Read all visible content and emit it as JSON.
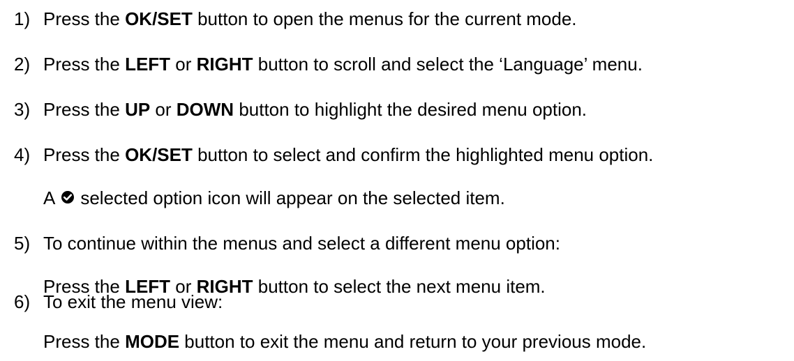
{
  "steps": [
    {
      "num": "1)",
      "p1": "Press the ",
      "b1": "OK/SET",
      "p2": " button to open the menus for the current mode."
    },
    {
      "num": "2)",
      "p1": "Press the ",
      "b1": "LEFT",
      "p2": " or ",
      "b2": "RIGHT",
      "p3": " button to scroll and select the ‘Language’ menu."
    },
    {
      "num": "3)",
      "p1": "Press the ",
      "b1": "UP",
      "p2": " or ",
      "b2": "DOWN",
      "p3": " button to highlight the desired menu option."
    },
    {
      "num": "4)",
      "p1": "Press the ",
      "b1": "OK/SET",
      "p2": " button to select and confirm the highlighted menu option.",
      "sub_p1": "A",
      "sub_p2": "selected option icon will appear on the selected item."
    },
    {
      "num": "5)",
      "p1": "To continue within the menus and select a different menu option:",
      "sub_p1": "Press the ",
      "sub_b1": "LEFT",
      "sub_p2": " or ",
      "sub_b2": "RIGHT",
      "sub_p3": " button to select the next menu item."
    },
    {
      "num": "6)",
      "p1": "To exit the menu view:",
      "sub_p1": "Press the ",
      "sub_b1": "MODE",
      "sub_p2": " button to exit the menu and return to your previous mode."
    }
  ],
  "icons": {
    "selected_option": "check-circle-icon"
  }
}
